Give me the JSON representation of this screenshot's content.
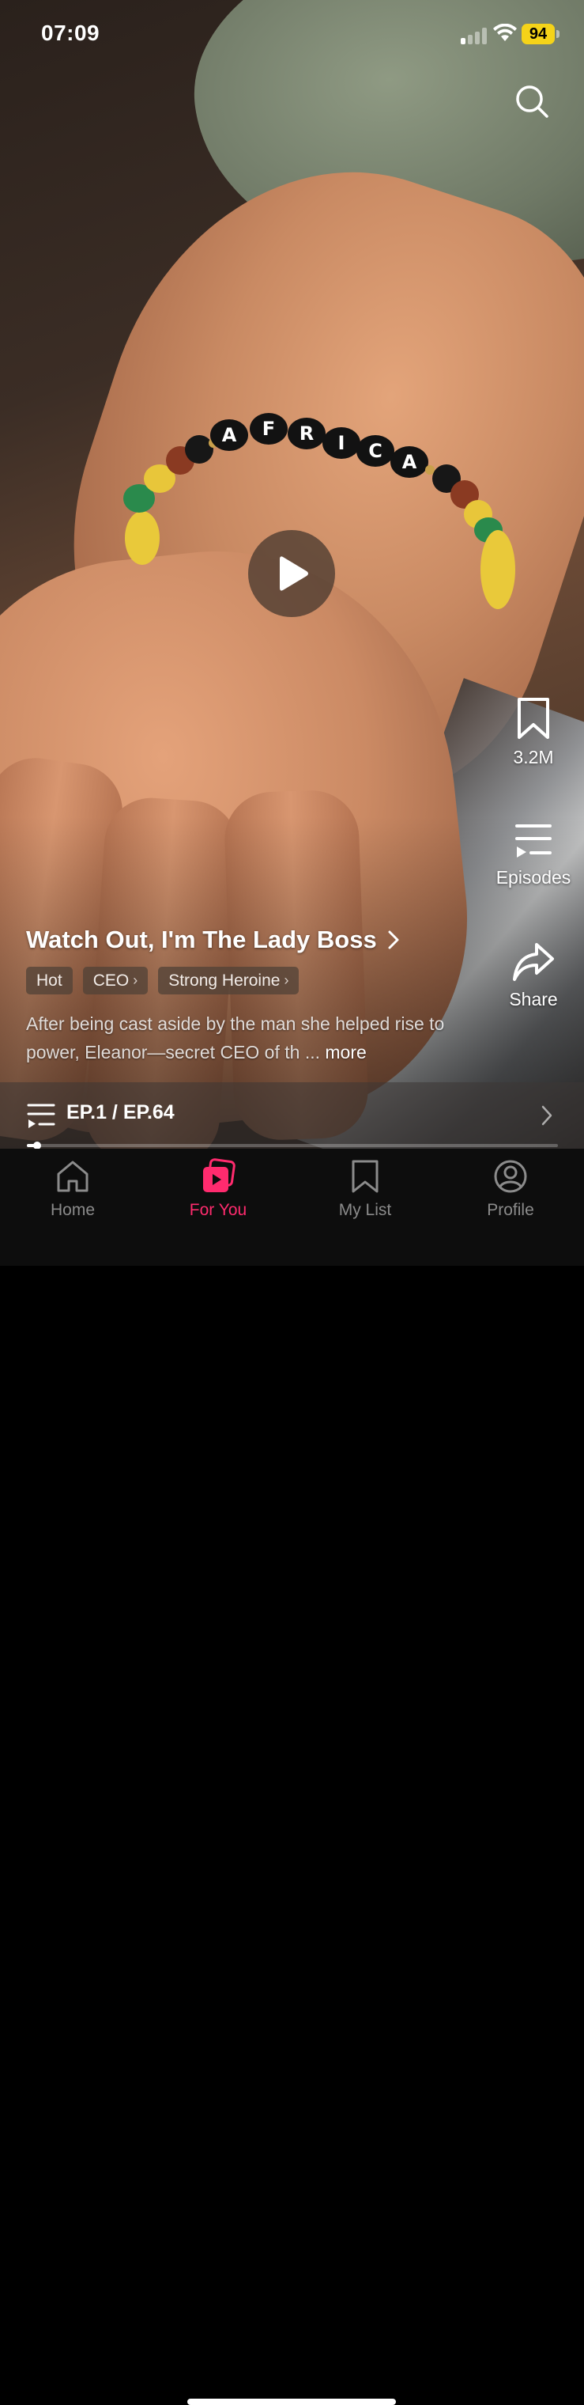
{
  "status_bar": {
    "time": "07:09",
    "battery": "94"
  },
  "video": {
    "bracelet_text": "AFRICA"
  },
  "side_actions": {
    "save_count": "3.2M",
    "episodes_label": "Episodes",
    "share_label": "Share"
  },
  "show": {
    "title": "Watch Out, I'm The Lady Boss",
    "tags": [
      "Hot",
      "CEO",
      "Strong Heroine"
    ],
    "description": "After being cast aside by the man she helped rise to power, Eleanor—secret CEO of th ...",
    "more_label": "more"
  },
  "episode_bar": {
    "label": "EP.1 / EP.64",
    "progress_fraction": 0.02
  },
  "tab_bar": {
    "tabs": [
      {
        "label": "Home",
        "icon": "home-icon"
      },
      {
        "label": "For You",
        "icon": "play-square-icon",
        "active": true
      },
      {
        "label": "My List",
        "icon": "bookmark-icon"
      },
      {
        "label": "Profile",
        "icon": "person-icon"
      }
    ]
  },
  "colors": {
    "accent": "#ff2b6e",
    "battery": "#f5d319"
  }
}
